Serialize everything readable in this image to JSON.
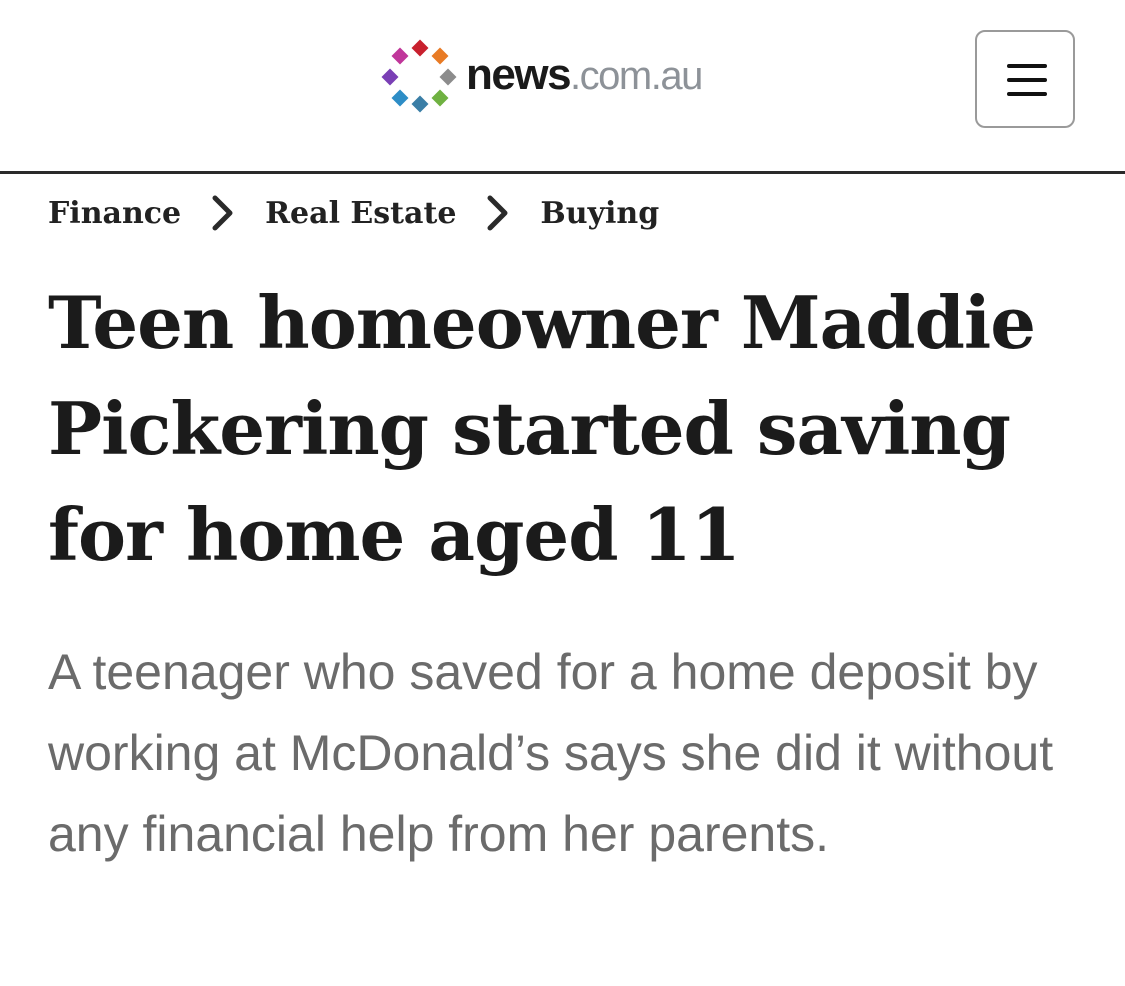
{
  "site": {
    "brand": "news",
    "tld": ".com.au",
    "logo_colors": [
      "#c8202e",
      "#e87b25",
      "#8c8c8c",
      "#6fb141",
      "#2d8dc6",
      "#3a7ea6",
      "#7a3fb5",
      "#c0369a"
    ]
  },
  "header": {
    "menu_icon": "hamburger-icon"
  },
  "breadcrumb": {
    "items": [
      {
        "label": "Finance"
      },
      {
        "label": "Real Estate"
      },
      {
        "label": "Buying"
      }
    ],
    "separator_icon": "chevron-right-icon"
  },
  "article": {
    "headline": "Teen homeowner Maddie Pickering started saving for home aged 11",
    "standfirst": "A teenager who saved for a home deposit by working at McDonald’s says she did it without any financial help from her parents."
  }
}
